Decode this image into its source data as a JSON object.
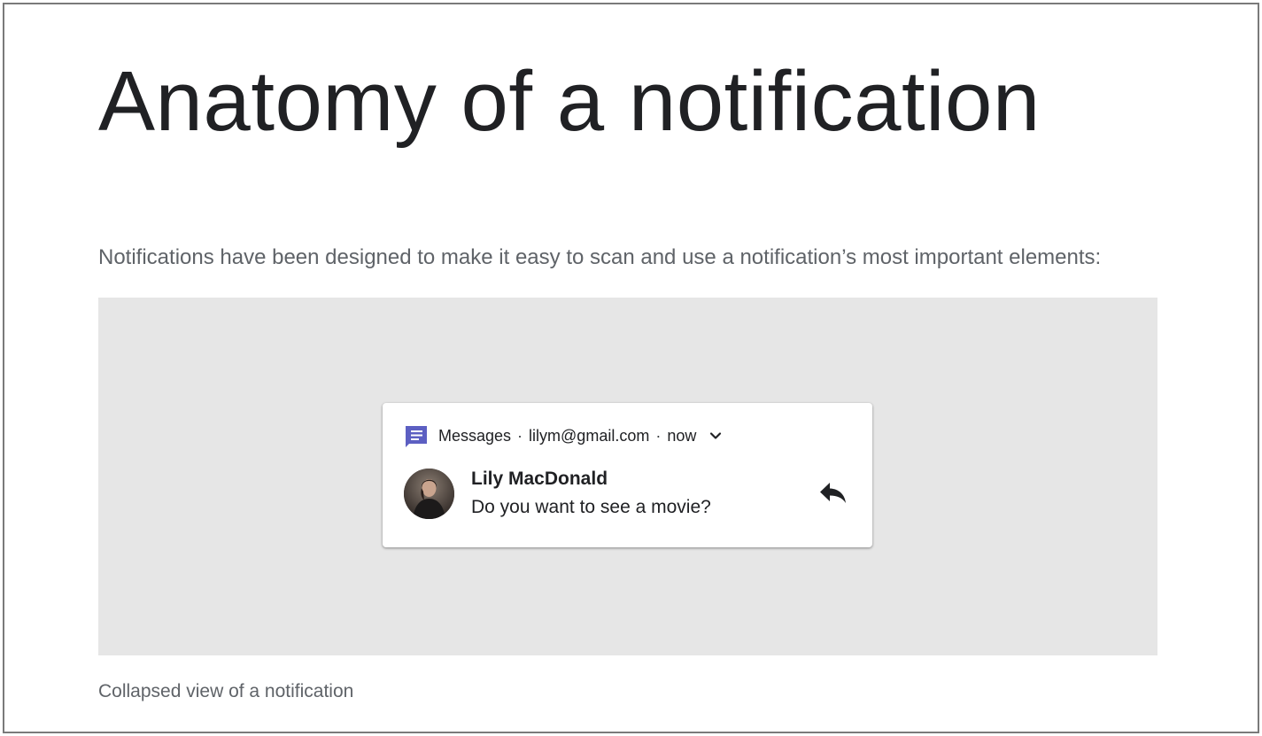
{
  "page": {
    "title": "Anatomy of a notification",
    "intro": "Notifications have been designed to make it easy to scan and use a notification’s most important elements:",
    "caption": "Collapsed view of a notification"
  },
  "notification": {
    "app_name": "Messages",
    "separator": "·",
    "account": "lilym@gmail.com",
    "time": "now",
    "sender": "Lily MacDonald",
    "message": "Do you want to see a movie?",
    "app_icon": "messages-icon",
    "expand_icon": "chevron-down-icon",
    "action_icon": "reply-icon",
    "app_color": "#5c5fc2"
  },
  "colors": {
    "stage_background": "#e6e6e6",
    "title_text": "#202124",
    "body_text": "#5f6368"
  }
}
